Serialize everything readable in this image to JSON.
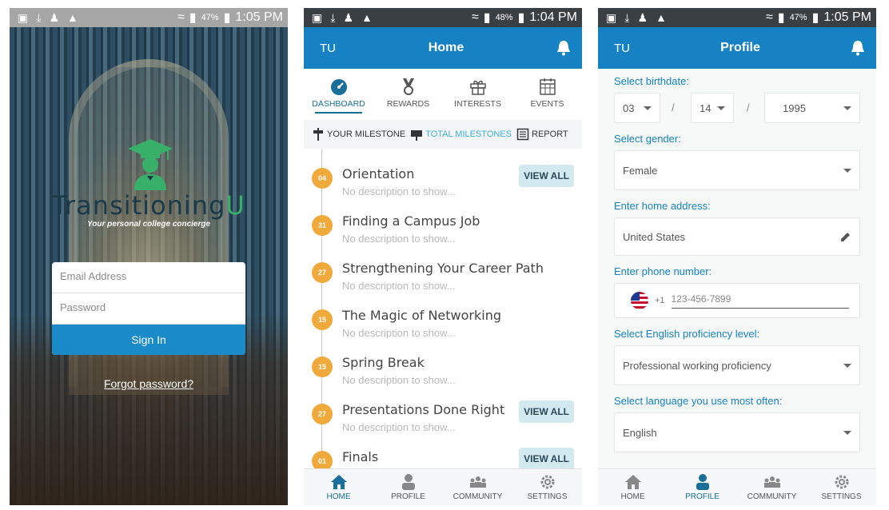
{
  "screens": {
    "login": {
      "status": {
        "battery": "47%",
        "time": "1:05 PM"
      },
      "brand": {
        "part1": "Transitioning",
        "part2": "U"
      },
      "tagline": "Your personal college concierge",
      "email_placeholder": "Email Address",
      "password_placeholder": "Password",
      "sign_in": "Sign In",
      "forgot_password": "Forgot password?"
    },
    "home": {
      "status": {
        "battery": "48%",
        "time": "1:04 PM"
      },
      "appbar": {
        "initials": "TU",
        "title": "Home"
      },
      "tabs": [
        {
          "label": "DASHBOARD",
          "icon": "dashboard-icon",
          "active": true
        },
        {
          "label": "REWARDS",
          "icon": "medal-icon"
        },
        {
          "label": "INTERESTS",
          "icon": "gift-icon"
        },
        {
          "label": "EVENTS",
          "icon": "calendar-icon"
        }
      ],
      "filters": [
        {
          "label": "YOUR MILESTONE",
          "icon": "signpost-icon"
        },
        {
          "label": "TOTAL MILESTONES",
          "icon": "flag-icon",
          "active": true
        },
        {
          "label": "REPORT",
          "icon": "report-icon"
        }
      ],
      "milestones": [
        {
          "day": "04",
          "title": "Orientation",
          "desc": "No description to show...",
          "view_all": "VIEW ALL"
        },
        {
          "day": "31",
          "title": "Finding a Campus Job",
          "desc": "No description to show..."
        },
        {
          "day": "27",
          "title": "Strengthening Your Career Path",
          "desc": "No description to show..."
        },
        {
          "day": "15",
          "title": "The Magic of Networking",
          "desc": "No description to show..."
        },
        {
          "day": "15",
          "title": "Spring Break",
          "desc": "No description to show..."
        },
        {
          "day": "27",
          "title": "Presentations Done Right",
          "desc": "No description to show...",
          "view_all": "VIEW ALL"
        },
        {
          "day": "01",
          "title": "Finals",
          "desc": "",
          "view_all": "VIEW ALL"
        }
      ],
      "nav": [
        {
          "label": "HOME",
          "active": true
        },
        {
          "label": "PROFILE"
        },
        {
          "label": "COMMUNITY"
        },
        {
          "label": "SETTINGS"
        }
      ]
    },
    "profile": {
      "status": {
        "battery": "47%",
        "time": "1:05 PM"
      },
      "appbar": {
        "initials": "TU",
        "title": "Profile"
      },
      "birthdate_label": "Select birthdate:",
      "birth_month": "03",
      "birth_day": "14",
      "birth_year": "1995",
      "separator": "/",
      "gender_label": "Select gender:",
      "gender": "Female",
      "address_label": "Enter home address:",
      "address": "United States",
      "phone_label": "Enter phone number:",
      "country_code": "+1",
      "phone_placeholder": "123-456-7899",
      "english_label": "Select English proficiency level:",
      "english": "Professional working proficiency",
      "language_label": "Select language you use most often:",
      "language": "English",
      "nav": [
        {
          "label": "HOME"
        },
        {
          "label": "PROFILE",
          "active": true
        },
        {
          "label": "COMMUNITY"
        },
        {
          "label": "SETTINGS"
        }
      ]
    }
  },
  "colors": {
    "primary": "#1682c4",
    "accent": "#3fb3d9",
    "badge": "#f0a93b",
    "brand_green": "#38b06a"
  }
}
